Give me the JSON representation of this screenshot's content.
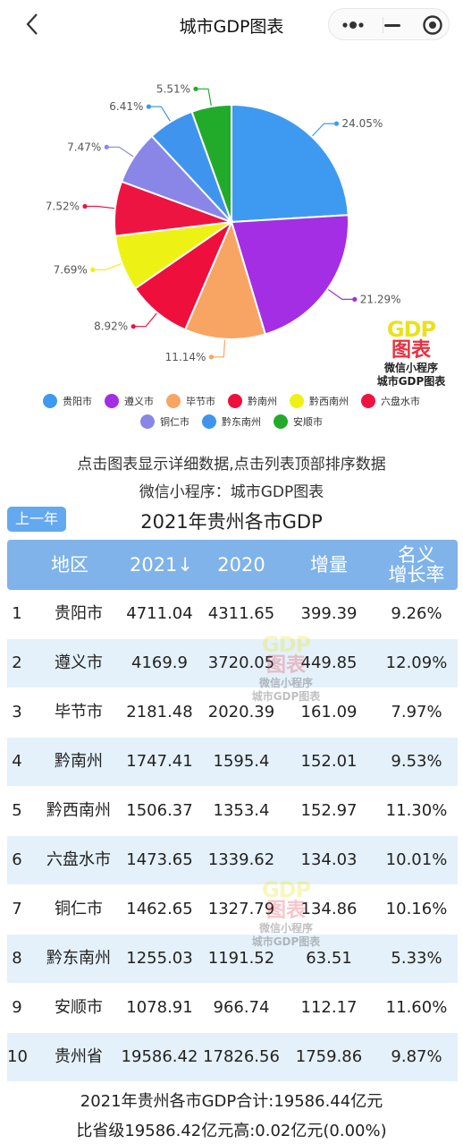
{
  "nav": {
    "title": "城市GDP图表"
  },
  "chart_data": {
    "type": "pie",
    "slices": [
      {
        "label": "贵阳市",
        "percent_label": "24.05%",
        "value": 24.05,
        "color": "#3e9af0"
      },
      {
        "label": "遵义市",
        "percent_label": "21.29%",
        "value": 21.29,
        "color": "#a32ee3"
      },
      {
        "label": "毕节市",
        "percent_label": "11.14%",
        "value": 11.14,
        "color": "#f8a564"
      },
      {
        "label": "黔南州",
        "percent_label": "8.92%",
        "value": 8.92,
        "color": "#ee0f3d"
      },
      {
        "label": "黔西南州",
        "percent_label": "7.69%",
        "value": 7.69,
        "color": "#eef214"
      },
      {
        "label": "六盘水市",
        "percent_label": "7.52%",
        "value": 7.52,
        "color": "#ee1441"
      },
      {
        "label": "铜仁市",
        "percent_label": "7.47%",
        "value": 7.47,
        "color": "#8a86e8"
      },
      {
        "label": "黔东南州",
        "percent_label": "6.41%",
        "value": 6.41,
        "color": "#3f95ee"
      },
      {
        "label": "安顺市",
        "percent_label": "5.51%",
        "value": 5.51,
        "color": "#22ab2b"
      }
    ]
  },
  "watermark": {
    "gdp": "GDP",
    "tu": "图表",
    "line1": "微信小程序",
    "line2": "城市GDP图表"
  },
  "tips": {
    "line1": "点击图表显示详细数据,点击列表顶部排序数据",
    "line2": "微信小程序：城市GDP图表"
  },
  "table": {
    "prev_button": "上一年",
    "title": "2021年贵州各市GDP",
    "headers": {
      "region": "地区",
      "y2021": "2021↓",
      "y2020": "2020",
      "increase": "增量",
      "rate1": "名义",
      "rate2": "增长率"
    },
    "rows": [
      {
        "rank": "1",
        "region": "贵阳市",
        "y2021": "4711.04",
        "y2020": "4311.65",
        "increase": "399.39",
        "rate": "9.26%"
      },
      {
        "rank": "2",
        "region": "遵义市",
        "y2021": "4169.9",
        "y2020": "3720.05",
        "increase": "449.85",
        "rate": "12.09%"
      },
      {
        "rank": "3",
        "region": "毕节市",
        "y2021": "2181.48",
        "y2020": "2020.39",
        "increase": "161.09",
        "rate": "7.97%"
      },
      {
        "rank": "4",
        "region": "黔南州",
        "y2021": "1747.41",
        "y2020": "1595.4",
        "increase": "152.01",
        "rate": "9.53%"
      },
      {
        "rank": "5",
        "region": "黔西南州",
        "y2021": "1506.37",
        "y2020": "1353.4",
        "increase": "152.97",
        "rate": "11.30%"
      },
      {
        "rank": "6",
        "region": "六盘水市",
        "y2021": "1473.65",
        "y2020": "1339.62",
        "increase": "134.03",
        "rate": "10.01%"
      },
      {
        "rank": "7",
        "region": "铜仁市",
        "y2021": "1462.65",
        "y2020": "1327.79",
        "increase": "134.86",
        "rate": "10.16%"
      },
      {
        "rank": "8",
        "region": "黔东南州",
        "y2021": "1255.03",
        "y2020": "1191.52",
        "increase": "63.51",
        "rate": "5.33%"
      },
      {
        "rank": "9",
        "region": "安顺市",
        "y2021": "1078.91",
        "y2020": "966.74",
        "increase": "112.17",
        "rate": "11.60%"
      },
      {
        "rank": "10",
        "region": "贵州省",
        "y2021": "19586.42",
        "y2020": "17826.56",
        "increase": "1759.86",
        "rate": "9.87%"
      }
    ]
  },
  "summary": {
    "line1": "2021年贵州各市GDP合计:19586.44亿元",
    "line2": "比省级19586.42亿元高:0.02亿元(0.00%)"
  }
}
